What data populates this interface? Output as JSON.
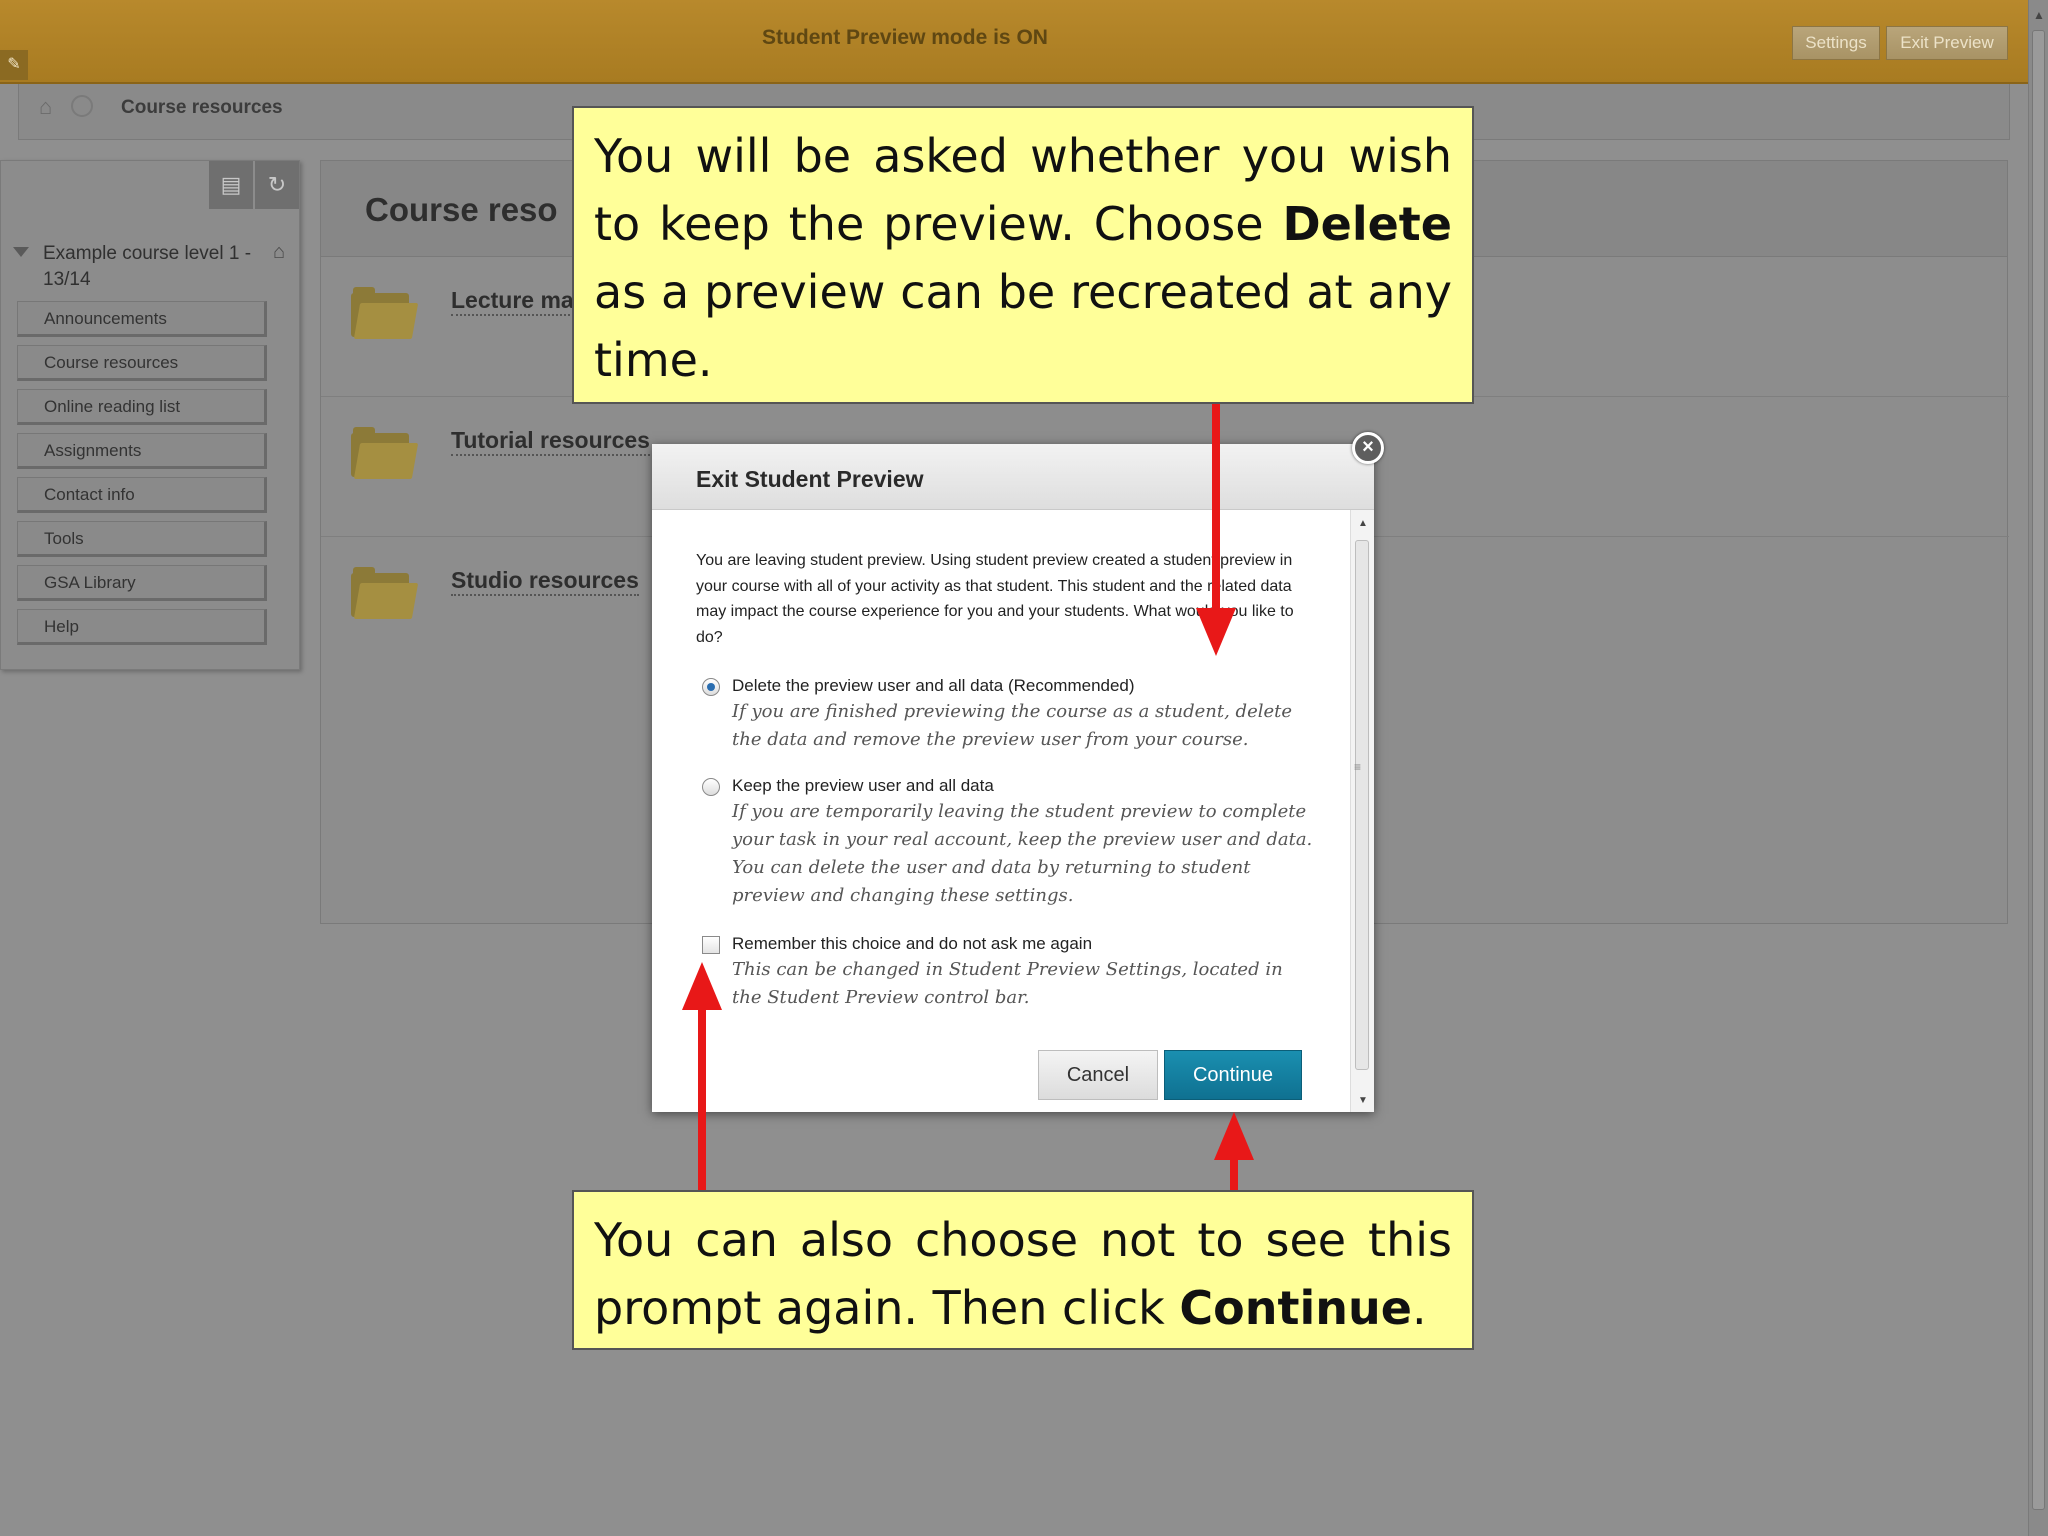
{
  "preview_bar": {
    "title": "Student Preview mode is ON",
    "settings_label": "Settings",
    "exit_label": "Exit Preview"
  },
  "breadcrumb": {
    "current": "Course resources"
  },
  "sidebar": {
    "course_name": "Example course level 1 - 13/14",
    "items": [
      {
        "label": "Announcements"
      },
      {
        "label": "Course resources"
      },
      {
        "label": "Online reading list"
      },
      {
        "label": "Assignments"
      },
      {
        "label": "Contact info"
      },
      {
        "label": "Tools"
      },
      {
        "label": "GSA Library"
      },
      {
        "label": "Help"
      }
    ]
  },
  "content": {
    "title": "Course reso",
    "rows": [
      {
        "label": "Lecture ma"
      },
      {
        "label": "Tutorial resources"
      },
      {
        "label": "Studio resources"
      }
    ]
  },
  "modal": {
    "title": "Exit Student Preview",
    "intro": "You are leaving student preview. Using student preview created a student preview in your course with all of your activity as that student. This student and the related data may impact the course experience for you and your students. What would you like to do?",
    "options": [
      {
        "label": "Delete the preview user and all data (Recommended)",
        "description": "If you are finished previewing the course as a student, delete the data and remove the preview user from your course.",
        "selected": true
      },
      {
        "label": "Keep the preview user and all data",
        "description": "If you are temporarily leaving the student preview to complete your task in your real account, keep the preview user and data. You can delete the user and data by returning to student preview and changing these settings.",
        "selected": false
      }
    ],
    "remember": {
      "label": "Remember this choice and do not ask me again",
      "description": "This can be changed in Student Preview Settings, located in the Student Preview control bar.",
      "checked": false
    },
    "cancel_label": "Cancel",
    "continue_label": "Continue"
  },
  "callouts": {
    "top": {
      "text_1": "You will be asked whether you wish to keep the preview. Choose ",
      "bold": "Delete",
      "text_2": " as a preview can be recreated at any time."
    },
    "bottom": {
      "text_1": "You can also choose not to see this prompt again. Then click ",
      "bold": "Continue",
      "text_2": "."
    }
  },
  "colors": {
    "preview_bar": "#b8892c",
    "continue_button": "#1a8fb0",
    "callout_fill": "#ffff99",
    "arrow": "#e81818"
  }
}
